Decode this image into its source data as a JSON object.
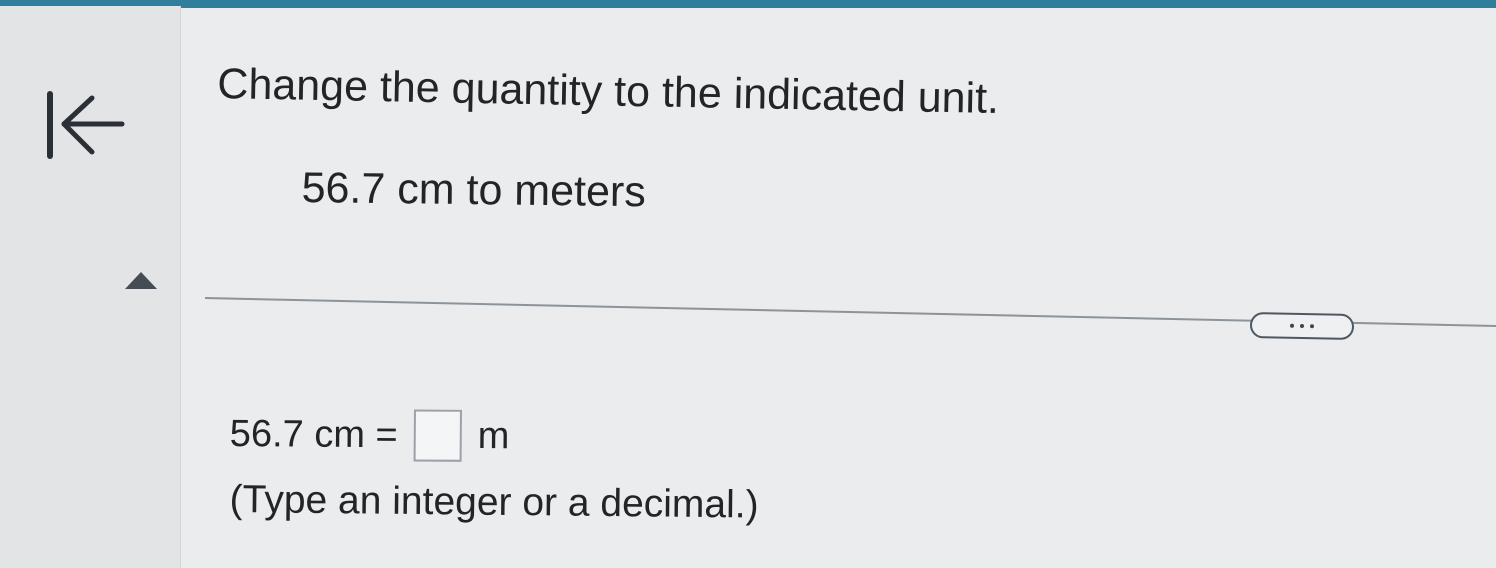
{
  "header": {
    "accent_color": "#2f7f9c"
  },
  "navigation": {
    "back_icon": "first-page-arrow-icon",
    "collapse_icon": "triangle-up-icon"
  },
  "question": {
    "instruction": "Change the quantity to the indicated unit.",
    "problem": "56.7 cm to meters"
  },
  "toolbar": {
    "more_icon": "more-options-icon"
  },
  "answer": {
    "quantity": "56.7 cm =",
    "value": "",
    "unit": "m",
    "hint": "(Type an integer or a decimal.)"
  }
}
